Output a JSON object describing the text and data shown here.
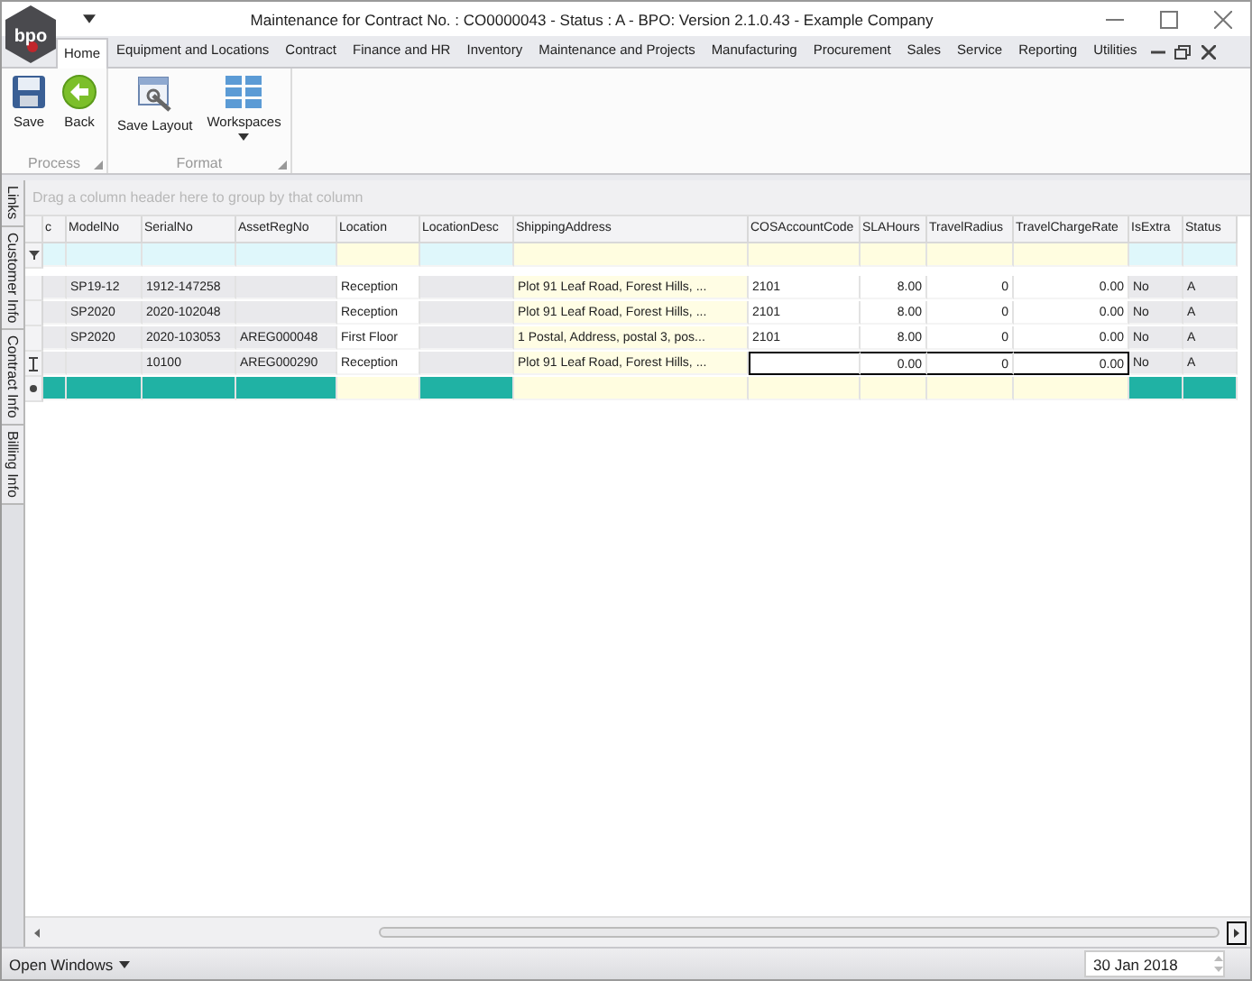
{
  "window": {
    "logo_text": "bpo",
    "title": "Maintenance for Contract No. : CO0000043 - Status : A - BPO: Version 2.1.0.43 - Example Company"
  },
  "ribbon_tabs": [
    {
      "label": "Home",
      "selected": true
    },
    {
      "label": "Equipment and Locations",
      "selected": false
    },
    {
      "label": "Contract",
      "selected": false
    },
    {
      "label": "Finance and HR",
      "selected": false
    },
    {
      "label": "Inventory",
      "selected": false
    },
    {
      "label": "Maintenance and Projects",
      "selected": false
    },
    {
      "label": "Manufacturing",
      "selected": false
    },
    {
      "label": "Procurement",
      "selected": false
    },
    {
      "label": "Sales",
      "selected": false
    },
    {
      "label": "Service",
      "selected": false
    },
    {
      "label": "Reporting",
      "selected": false
    },
    {
      "label": "Utilities",
      "selected": false
    }
  ],
  "ribbon_groups": [
    {
      "label": "Process",
      "buttons": [
        {
          "label": "Save",
          "dropdown": false
        },
        {
          "label": "Back",
          "dropdown": false
        }
      ]
    },
    {
      "label": "Format",
      "buttons": [
        {
          "label": "Save Layout",
          "dropdown": false
        },
        {
          "label": "Workspaces",
          "dropdown": true
        }
      ]
    }
  ],
  "side_tabs": [
    "Links",
    "Customer Info",
    "Contract Info",
    "Billing Info"
  ],
  "grid": {
    "group_panel_hint": "Drag a column header here to group by that column",
    "columns": [
      {
        "label": "c",
        "kind": "readonly"
      },
      {
        "label": "ModelNo",
        "kind": "readonly",
        "numeric": false
      },
      {
        "label": "SerialNo",
        "kind": "readonly",
        "numeric": false
      },
      {
        "label": "AssetRegNo",
        "kind": "readonly",
        "numeric": false
      },
      {
        "label": "Location",
        "kind": "editable",
        "numeric": false
      },
      {
        "label": "LocationDesc",
        "kind": "readonly"
      },
      {
        "label": "ShippingAddress",
        "kind": "address",
        "numeric": false
      },
      {
        "label": "COSAccountCode",
        "kind": "entry",
        "numeric": false
      },
      {
        "label": "SLAHours",
        "kind": "entry",
        "numeric": true
      },
      {
        "label": "TravelRadius",
        "kind": "entry",
        "numeric": true
      },
      {
        "label": "TravelChargeRate",
        "kind": "entry",
        "numeric": true
      },
      {
        "label": "IsExtra",
        "kind": "readonly",
        "numeric": false
      },
      {
        "label": "Status",
        "kind": "readonly",
        "numeric": false
      }
    ],
    "rows": [
      {
        "editing": false,
        "cells": [
          null,
          "SP19-12",
          "1912-147258",
          null,
          "Reception",
          null,
          "Plot 91 Leaf Road, Forest Hills, ...",
          "2101",
          "8.00",
          "0",
          "0.00",
          "No",
          "A"
        ]
      },
      {
        "editing": false,
        "cells": [
          null,
          "SP2020",
          "2020-102048",
          null,
          "Reception",
          null,
          "Plot 91 Leaf Road, Forest Hills, ...",
          "2101",
          "8.00",
          "0",
          "0.00",
          "No",
          "A"
        ]
      },
      {
        "editing": false,
        "cells": [
          null,
          "SP2020",
          "2020-103053",
          "AREG000048",
          "First Floor",
          null,
          "1 Postal, Address, postal 3, pos...",
          "2101",
          "8.00",
          "0",
          "0.00",
          "No",
          "A"
        ]
      },
      {
        "editing": true,
        "cells": [
          null,
          null,
          "10100",
          "AREG000290",
          "Reception",
          null,
          "Plot 91 Leaf Road, Forest Hills, ...",
          null,
          "0.00",
          "0",
          "0.00",
          "No",
          "A"
        ]
      }
    ]
  },
  "status_bar": {
    "open_windows": "Open Windows",
    "date": "30 Jan 2018"
  }
}
